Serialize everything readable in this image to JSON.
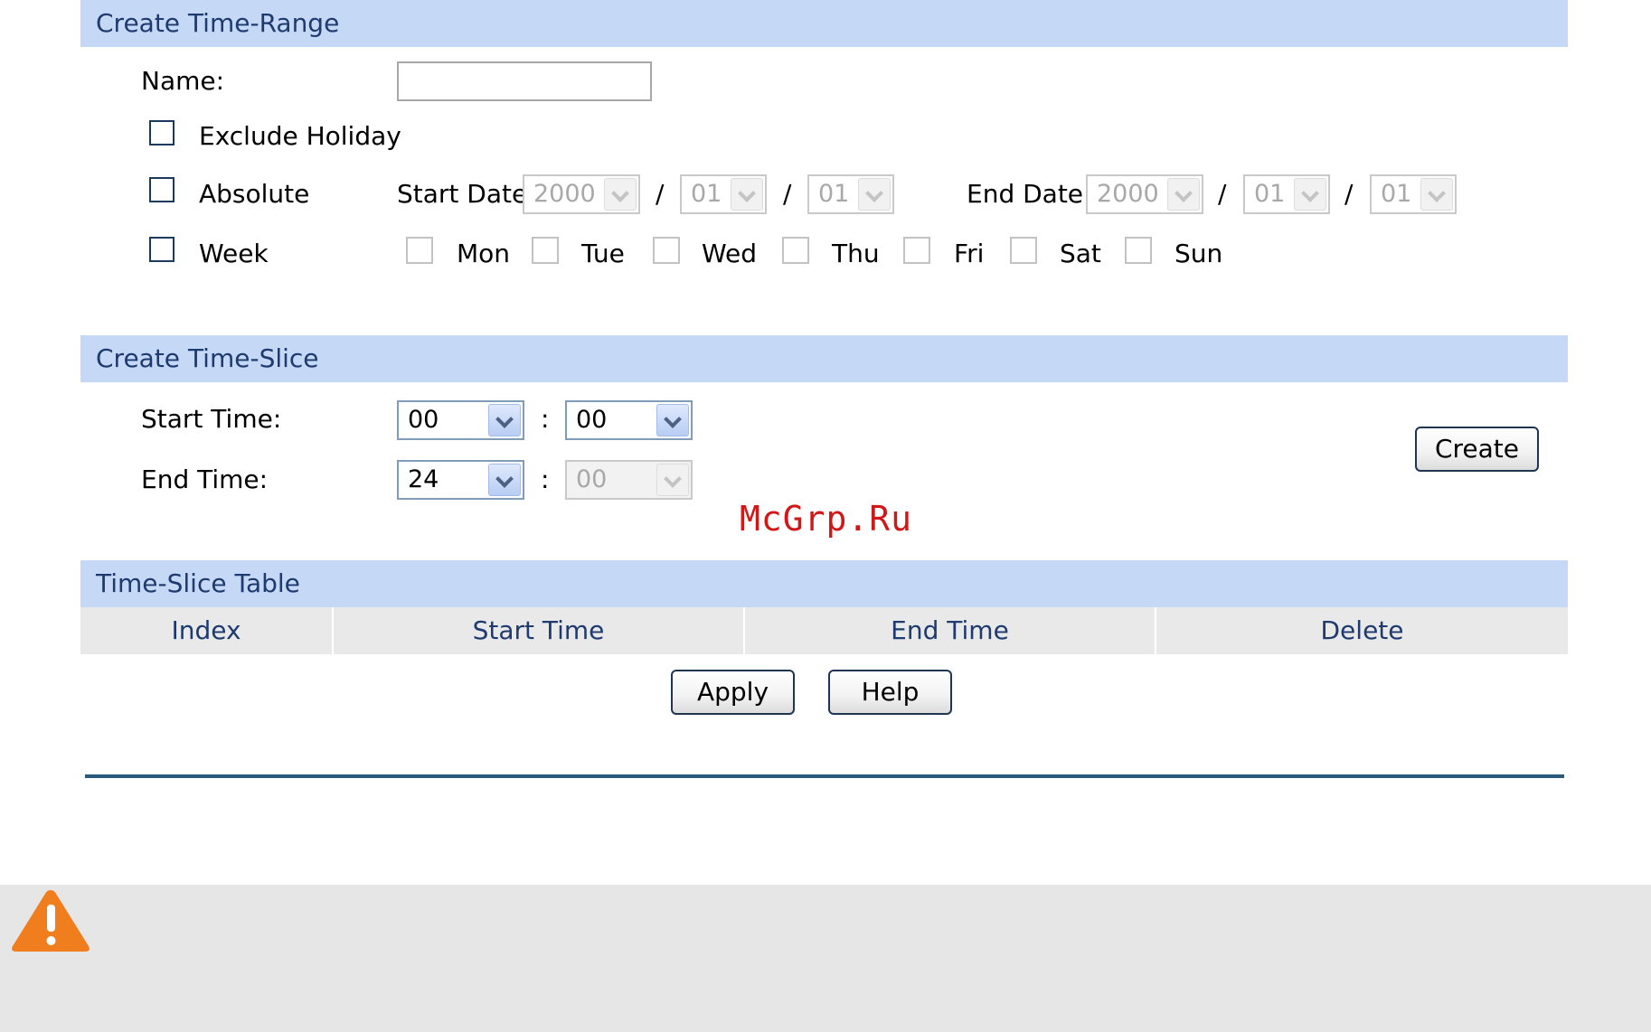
{
  "time_range": {
    "header": "Create Time-Range",
    "name_label": "Name:",
    "name_value": "",
    "exclude_holiday": "Exclude Holiday",
    "absolute": "Absolute",
    "start_date_label": "Start Date:",
    "start_date": {
      "year": "2000",
      "month": "01",
      "day": "01"
    },
    "end_date_label": "End Date:",
    "end_date": {
      "year": "2000",
      "month": "01",
      "day": "01"
    },
    "date_sep": "/",
    "week": "Week",
    "days": [
      "Mon",
      "Tue",
      "Wed",
      "Thu",
      "Fri",
      "Sat",
      "Sun"
    ]
  },
  "time_slice": {
    "header": "Create Time-Slice",
    "start_label": "Start Time:",
    "start_hour": "00",
    "start_minute": "00",
    "end_label": "End Time:",
    "end_hour": "24",
    "end_minute": "00",
    "time_sep": ":",
    "create_button": "Create"
  },
  "watermark": "McGrp.Ru",
  "table": {
    "header": "Time-Slice Table",
    "columns": [
      "Index",
      "Start Time",
      "End Time",
      "Delete"
    ]
  },
  "actions": {
    "apply": "Apply",
    "help": "Help"
  },
  "colors": {
    "header_bg": "#c5d9f7",
    "header_text": "#1e3a6e",
    "warning": "#f07d1e"
  },
  "icons": {
    "warning": "warning-icon"
  }
}
